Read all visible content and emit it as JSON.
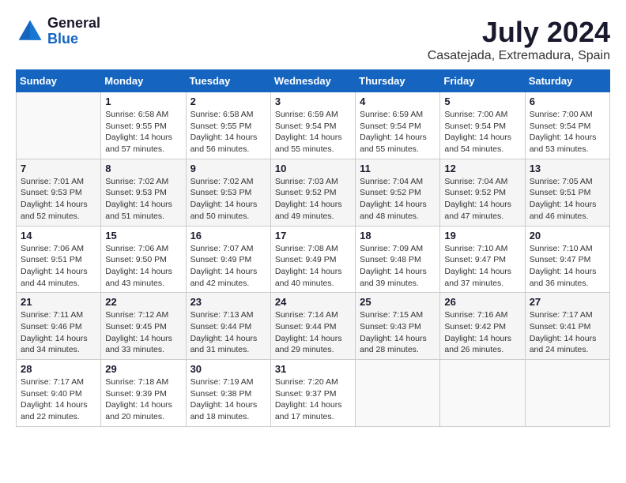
{
  "logo": {
    "line1": "General",
    "line2": "Blue"
  },
  "header": {
    "month_year": "July 2024",
    "location": "Casatejada, Extremadura, Spain"
  },
  "weekdays": [
    "Sunday",
    "Monday",
    "Tuesday",
    "Wednesday",
    "Thursday",
    "Friday",
    "Saturday"
  ],
  "weeks": [
    [
      {
        "day": "",
        "content": ""
      },
      {
        "day": "1",
        "content": "Sunrise: 6:58 AM\nSunset: 9:55 PM\nDaylight: 14 hours\nand 57 minutes."
      },
      {
        "day": "2",
        "content": "Sunrise: 6:58 AM\nSunset: 9:55 PM\nDaylight: 14 hours\nand 56 minutes."
      },
      {
        "day": "3",
        "content": "Sunrise: 6:59 AM\nSunset: 9:54 PM\nDaylight: 14 hours\nand 55 minutes."
      },
      {
        "day": "4",
        "content": "Sunrise: 6:59 AM\nSunset: 9:54 PM\nDaylight: 14 hours\nand 55 minutes."
      },
      {
        "day": "5",
        "content": "Sunrise: 7:00 AM\nSunset: 9:54 PM\nDaylight: 14 hours\nand 54 minutes."
      },
      {
        "day": "6",
        "content": "Sunrise: 7:00 AM\nSunset: 9:54 PM\nDaylight: 14 hours\nand 53 minutes."
      }
    ],
    [
      {
        "day": "7",
        "content": "Sunrise: 7:01 AM\nSunset: 9:53 PM\nDaylight: 14 hours\nand 52 minutes."
      },
      {
        "day": "8",
        "content": "Sunrise: 7:02 AM\nSunset: 9:53 PM\nDaylight: 14 hours\nand 51 minutes."
      },
      {
        "day": "9",
        "content": "Sunrise: 7:02 AM\nSunset: 9:53 PM\nDaylight: 14 hours\nand 50 minutes."
      },
      {
        "day": "10",
        "content": "Sunrise: 7:03 AM\nSunset: 9:52 PM\nDaylight: 14 hours\nand 49 minutes."
      },
      {
        "day": "11",
        "content": "Sunrise: 7:04 AM\nSunset: 9:52 PM\nDaylight: 14 hours\nand 48 minutes."
      },
      {
        "day": "12",
        "content": "Sunrise: 7:04 AM\nSunset: 9:52 PM\nDaylight: 14 hours\nand 47 minutes."
      },
      {
        "day": "13",
        "content": "Sunrise: 7:05 AM\nSunset: 9:51 PM\nDaylight: 14 hours\nand 46 minutes."
      }
    ],
    [
      {
        "day": "14",
        "content": "Sunrise: 7:06 AM\nSunset: 9:51 PM\nDaylight: 14 hours\nand 44 minutes."
      },
      {
        "day": "15",
        "content": "Sunrise: 7:06 AM\nSunset: 9:50 PM\nDaylight: 14 hours\nand 43 minutes."
      },
      {
        "day": "16",
        "content": "Sunrise: 7:07 AM\nSunset: 9:49 PM\nDaylight: 14 hours\nand 42 minutes."
      },
      {
        "day": "17",
        "content": "Sunrise: 7:08 AM\nSunset: 9:49 PM\nDaylight: 14 hours\nand 40 minutes."
      },
      {
        "day": "18",
        "content": "Sunrise: 7:09 AM\nSunset: 9:48 PM\nDaylight: 14 hours\nand 39 minutes."
      },
      {
        "day": "19",
        "content": "Sunrise: 7:10 AM\nSunset: 9:47 PM\nDaylight: 14 hours\nand 37 minutes."
      },
      {
        "day": "20",
        "content": "Sunrise: 7:10 AM\nSunset: 9:47 PM\nDaylight: 14 hours\nand 36 minutes."
      }
    ],
    [
      {
        "day": "21",
        "content": "Sunrise: 7:11 AM\nSunset: 9:46 PM\nDaylight: 14 hours\nand 34 minutes."
      },
      {
        "day": "22",
        "content": "Sunrise: 7:12 AM\nSunset: 9:45 PM\nDaylight: 14 hours\nand 33 minutes."
      },
      {
        "day": "23",
        "content": "Sunrise: 7:13 AM\nSunset: 9:44 PM\nDaylight: 14 hours\nand 31 minutes."
      },
      {
        "day": "24",
        "content": "Sunrise: 7:14 AM\nSunset: 9:44 PM\nDaylight: 14 hours\nand 29 minutes."
      },
      {
        "day": "25",
        "content": "Sunrise: 7:15 AM\nSunset: 9:43 PM\nDaylight: 14 hours\nand 28 minutes."
      },
      {
        "day": "26",
        "content": "Sunrise: 7:16 AM\nSunset: 9:42 PM\nDaylight: 14 hours\nand 26 minutes."
      },
      {
        "day": "27",
        "content": "Sunrise: 7:17 AM\nSunset: 9:41 PM\nDaylight: 14 hours\nand 24 minutes."
      }
    ],
    [
      {
        "day": "28",
        "content": "Sunrise: 7:17 AM\nSunset: 9:40 PM\nDaylight: 14 hours\nand 22 minutes."
      },
      {
        "day": "29",
        "content": "Sunrise: 7:18 AM\nSunset: 9:39 PM\nDaylight: 14 hours\nand 20 minutes."
      },
      {
        "day": "30",
        "content": "Sunrise: 7:19 AM\nSunset: 9:38 PM\nDaylight: 14 hours\nand 18 minutes."
      },
      {
        "day": "31",
        "content": "Sunrise: 7:20 AM\nSunset: 9:37 PM\nDaylight: 14 hours\nand 17 minutes."
      },
      {
        "day": "",
        "content": ""
      },
      {
        "day": "",
        "content": ""
      },
      {
        "day": "",
        "content": ""
      }
    ]
  ]
}
